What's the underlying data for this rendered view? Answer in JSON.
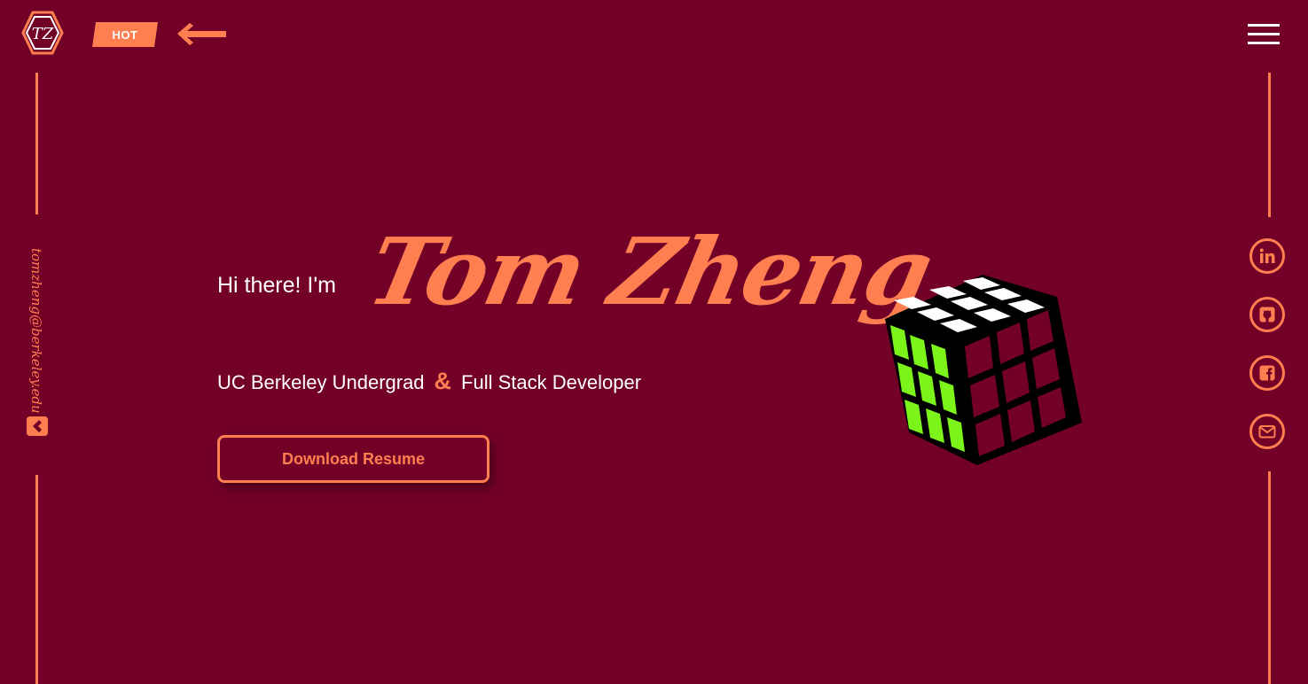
{
  "header": {
    "logo_icon": "tz-hexagon-logo-icon",
    "hot_label": "HOT",
    "arrow_icon": "arrow-left-icon",
    "menu_icon": "hamburger-menu-icon"
  },
  "sidebar_left": {
    "email": "tomzheng@berkeley.edu",
    "email_icon": "tag-diamond-icon"
  },
  "sidebar_right": {
    "social_icons": [
      "linkedin-icon",
      "github-icon",
      "facebook-icon",
      "mail-icon"
    ]
  },
  "hero": {
    "greeting": "Hi there! I'm",
    "name": "Tom Zheng",
    "role_1": "UC Berkeley Undergrad",
    "ampersand": "&",
    "role_2": "Full Stack Developer",
    "resume_button": "Download Resume",
    "image_icon": "rubiks-cube-illustration"
  },
  "colors": {
    "background": "#720027",
    "accent": "#ff7f50",
    "text": "#ffffff",
    "cube_green": "#7cf41a",
    "cube_white": "#ffffff",
    "cube_red": "#720027"
  }
}
